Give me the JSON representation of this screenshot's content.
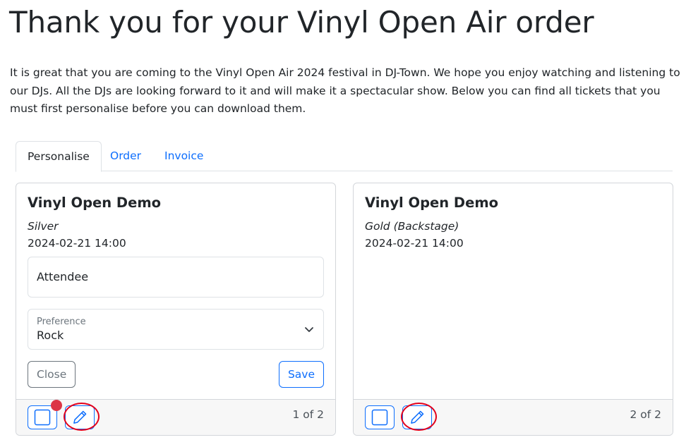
{
  "page": {
    "title": "Thank you for your Vinyl Open Air order",
    "intro": "It is great that you are coming to the Vinyl Open Air 2024 festival in DJ-Town. We hope you enjoy watching and listening to our DJs. All the DJs are looking forward to it and will make it a spectacular show. Below you can find all tickets that you must first personalise before you can download them."
  },
  "tabs": [
    {
      "label": "Personalise",
      "active": true
    },
    {
      "label": "Order",
      "active": false
    },
    {
      "label": "Invoice",
      "active": false
    }
  ],
  "tickets": [
    {
      "event": "Vinyl Open Demo",
      "type": "Silver",
      "date": "2024-02-21 14:00",
      "form": {
        "attendee_placeholder": "Attendee",
        "preference_label": "Preference",
        "preference_value": "Rock",
        "close_label": "Close",
        "save_label": "Save"
      },
      "pager": "1 of 2",
      "has_notification": true
    },
    {
      "event": "Vinyl Open Demo",
      "type": "Gold (Backstage)",
      "date": "2024-02-21 14:00",
      "pager": "2 of 2",
      "has_notification": false
    }
  ],
  "icons": {
    "check": "checkbox-square-icon",
    "edit": "pencil-icon",
    "select": "chevron-down-icon"
  },
  "colors": {
    "primary": "#0d6efd",
    "secondary": "#6c757d",
    "notification": "#dc3545",
    "highlight": "#e3001b"
  }
}
